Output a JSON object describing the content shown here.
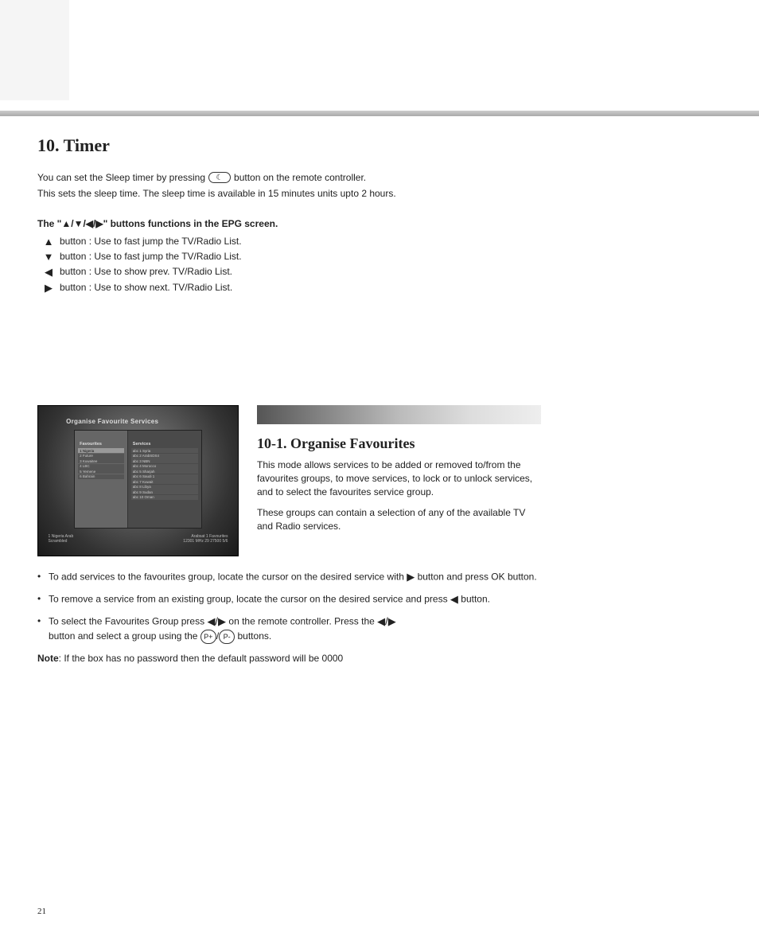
{
  "section_title": "10. Timer",
  "intro_line_pre": "You can set the Sleep timer by pressing",
  "intro_line_post": "button on the remote controller.",
  "sleep_icon_glyph": "☾",
  "intro_para": "This sets the sleep time. The sleep time is available in 15 minutes units upto 2 hours.",
  "buttons_header": "The \"▲/▼/◀/▶\" buttons functions in the EPG screen.",
  "button_rows": [
    {
      "arrow": "▲",
      "desc": "button : Use to fast jump the TV/Radio List."
    },
    {
      "arrow": "▼",
      "desc": "button : Use to fast jump the TV/Radio List."
    },
    {
      "arrow": "◀",
      "desc": "button : Use to show prev. TV/Radio List."
    },
    {
      "arrow": "▶",
      "desc": "button : Use to show next. TV/Radio List."
    }
  ],
  "subsection_title": "10-1. Organise Favourites",
  "right_block": {
    "p1": "This mode allows services to be added or removed to/from the favourites groups, to move services, to lock or to unlock services, and to select the favourites service group.",
    "p2": "These groups can contain a selection of any of the available TV and Radio services."
  },
  "lower_bullets": [
    {
      "pre": "To add services to the favourites group, locate the cursor on the desired service with ",
      "post": "button and press OK button."
    },
    {
      "pre": "To remove a service from an existing group, locate the cursor on the desired service and press ",
      "post": "button."
    }
  ],
  "lower_paras": {
    "select_group_pre": "To select the Favourites Group press ",
    "select_group_mid1": " on the remote controller. Press the ",
    "select_group_mid2": " button and select a group using the ",
    "select_group_post_btns": " buttons."
  },
  "arrows": {
    "left_right": "◀/▶",
    "right": "▶",
    "left": "◀"
  },
  "p_plus": "P+",
  "p_minus": "P-",
  "note_label": "Note",
  "note_text": ": If the box has no password then the default password will be 0000",
  "screenshot": {
    "title": "Organise Favourite Services",
    "left_header": "Favourites",
    "right_header": "Services",
    "left_items": [
      "1 Nigeria",
      "2 Future",
      "3 Kuwaitee",
      "4 LBC",
      "5 Yemene",
      "6 Bahrain"
    ],
    "right_items": [
      "abc   1 Syria",
      "abc   2 ArabSDS4",
      "abc   3 NBN",
      "abc   4 Morocco",
      "abc   5 Sharjah",
      "abc   6 Saudi 1",
      "abc   7 Kuwait",
      "abc   8 Libya",
      "abc   9 Sudan",
      "abc   10 Oman"
    ],
    "footer_left_line1": "1 Nigeria    Arab",
    "footer_left_line2": "Scrambled",
    "footer_right_line1": "Arabsat 1 Favourites",
    "footer_right_line2": "12301 MHz 29 27500 5/6"
  },
  "page_number": "21"
}
